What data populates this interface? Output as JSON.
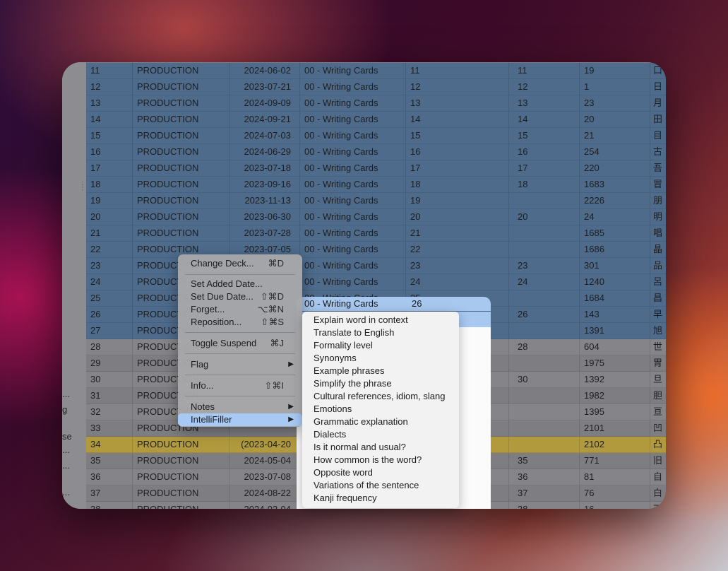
{
  "side_fragments": [
    "...",
    "g",
    "se",
    "...",
    "...",
    "..."
  ],
  "rows": [
    {
      "n": "11",
      "deck": "PRODUCTION",
      "date": "2024-06-02",
      "notetype": "00 - Writing Cards",
      "f1": "11",
      "f2": "11",
      "f3": "19",
      "k": "口",
      "style": "sel"
    },
    {
      "n": "12",
      "deck": "PRODUCTION",
      "date": "2023-07-21",
      "notetype": "00 - Writing Cards",
      "f1": "12",
      "f2": "12",
      "f3": "1",
      "k": "日",
      "style": "sel"
    },
    {
      "n": "13",
      "deck": "PRODUCTION",
      "date": "2024-09-09",
      "notetype": "00 - Writing Cards",
      "f1": "13",
      "f2": "13",
      "f3": "23",
      "k": "月",
      "style": "sel"
    },
    {
      "n": "14",
      "deck": "PRODUCTION",
      "date": "2024-09-21",
      "notetype": "00 - Writing Cards",
      "f1": "14",
      "f2": "14",
      "f3": "20",
      "k": "田",
      "style": "sel"
    },
    {
      "n": "15",
      "deck": "PRODUCTION",
      "date": "2024-07-03",
      "notetype": "00 - Writing Cards",
      "f1": "15",
      "f2": "15",
      "f3": "21",
      "k": "目",
      "style": "sel"
    },
    {
      "n": "16",
      "deck": "PRODUCTION",
      "date": "2024-06-29",
      "notetype": "00 - Writing Cards",
      "f1": "16",
      "f2": "16",
      "f3": "254",
      "k": "古",
      "style": "sel"
    },
    {
      "n": "17",
      "deck": "PRODUCTION",
      "date": "2023-07-18",
      "notetype": "00 - Writing Cards",
      "f1": "17",
      "f2": "17",
      "f3": "220",
      "k": "吾",
      "style": "sel"
    },
    {
      "n": "18",
      "deck": "PRODUCTION",
      "date": "2023-09-16",
      "notetype": "00 - Writing Cards",
      "f1": "18",
      "f2": "18",
      "f3": "1683",
      "k": "冒",
      "style": "sel"
    },
    {
      "n": "19",
      "deck": "PRODUCTION",
      "date": "2023-11-13",
      "notetype": "00 - Writing Cards",
      "f1": "19",
      "f2": "",
      "f3": "2226",
      "k": "朋",
      "style": "sel"
    },
    {
      "n": "20",
      "deck": "PRODUCTION",
      "date": "2023-06-30",
      "notetype": "00 - Writing Cards",
      "f1": "20",
      "f2": "20",
      "f3": "24",
      "k": "明",
      "style": "sel"
    },
    {
      "n": "21",
      "deck": "PRODUCTION",
      "date": "2023-07-28",
      "notetype": "00 - Writing Cards",
      "f1": "21",
      "f2": "",
      "f3": "1685",
      "k": "唱",
      "style": "sel"
    },
    {
      "n": "22",
      "deck": "PRODUCTION",
      "date": "2023-07-05",
      "notetype": "00 - Writing Cards",
      "f1": "22",
      "f2": "",
      "f3": "1686",
      "k": "晶",
      "style": "sel"
    },
    {
      "n": "23",
      "deck": "PRODUCTION",
      "date": "",
      "notetype": "00 - Writing Cards",
      "f1": "23",
      "f2": "23",
      "f3": "301",
      "k": "品",
      "style": "sel"
    },
    {
      "n": "24",
      "deck": "PRODUCTION",
      "date": "",
      "notetype": "00 - Writing Cards",
      "f1": "24",
      "f2": "24",
      "f3": "1240",
      "k": "呂",
      "style": "sel"
    },
    {
      "n": "25",
      "deck": "PRODUCTION",
      "date": "",
      "notetype": "00 - Writing Cards",
      "f1": "25",
      "f2": "",
      "f3": "1684",
      "k": "昌",
      "style": "sel"
    },
    {
      "n": "26",
      "deck": "PRODUCTION",
      "date": "",
      "notetype": "",
      "f1": "",
      "f2": "26",
      "f3": "143",
      "k": "早",
      "style": "sel"
    },
    {
      "n": "27",
      "deck": "PRODUCTION",
      "date": "",
      "notetype": "",
      "f1": "",
      "f2": "",
      "f3": "1391",
      "k": "旭",
      "style": "sel"
    },
    {
      "n": "28",
      "deck": "PRODUCTION",
      "date": "",
      "notetype": "",
      "f1": "",
      "f2": "28",
      "f3": "604",
      "k": "世",
      "style": "gray"
    },
    {
      "n": "29",
      "deck": "PRODUCTION",
      "date": "",
      "notetype": "",
      "f1": "",
      "f2": "",
      "f3": "1975",
      "k": "胃",
      "style": "gray alt"
    },
    {
      "n": "30",
      "deck": "PRODUCTION",
      "date": "",
      "notetype": "",
      "f1": "",
      "f2": "30",
      "f3": "1392",
      "k": "旦",
      "style": "gray"
    },
    {
      "n": "31",
      "deck": "PRODUCTION",
      "date": "",
      "notetype": "",
      "f1": "",
      "f2": "",
      "f3": "1982",
      "k": "胆",
      "style": "gray alt"
    },
    {
      "n": "32",
      "deck": "PRODUCTION",
      "date": "",
      "notetype": "",
      "f1": "",
      "f2": "",
      "f3": "1395",
      "k": "亘",
      "style": "gray"
    },
    {
      "n": "33",
      "deck": "PRODUCTION",
      "date": "",
      "notetype": "",
      "f1": "",
      "f2": "",
      "f3": "2101",
      "k": "凹",
      "style": "gray alt"
    },
    {
      "n": "34",
      "deck": "PRODUCTION",
      "date": "(2023-04-20",
      "notetype": "",
      "f1": "",
      "f2": "",
      "f3": "2102",
      "k": "凸",
      "style": "hl"
    },
    {
      "n": "35",
      "deck": "PRODUCTION",
      "date": "2024-05-04",
      "notetype": "",
      "f1": "",
      "f2": "35",
      "f3": "771",
      "k": "旧",
      "style": "gray alt"
    },
    {
      "n": "36",
      "deck": "PRODUCTION",
      "date": "2023-07-08",
      "notetype": "",
      "f1": "",
      "f2": "36",
      "f3": "81",
      "k": "自",
      "style": "gray"
    },
    {
      "n": "37",
      "deck": "PRODUCTION",
      "date": "2024-08-22",
      "notetype": "",
      "f1": "",
      "f2": "37",
      "f3": "76",
      "k": "白",
      "style": "gray alt"
    },
    {
      "n": "38",
      "deck": "PRODUCTION",
      "date": "2024-03-04",
      "notetype": "",
      "f1": "",
      "f2": "38",
      "f3": "16",
      "k": "百",
      "style": "gray"
    }
  ],
  "highlight_row": {
    "notetype": "00 - Writing Cards",
    "f1": "26"
  },
  "context_menu": {
    "items": [
      {
        "label": "Change Deck...",
        "shortcut": "⌘D"
      },
      {
        "label": "Set Added Date...",
        "shortcut": ""
      },
      {
        "label": "Set Due Date...",
        "shortcut": "⇧⌘D"
      },
      {
        "label": "Forget...",
        "shortcut": "⌥⌘N"
      },
      {
        "label": "Reposition...",
        "shortcut": "⇧⌘S"
      },
      {
        "label": "Toggle Suspend",
        "shortcut": "⌘J"
      },
      {
        "label": "Flag",
        "shortcut": ""
      },
      {
        "label": "Info...",
        "shortcut": "⇧⌘I"
      },
      {
        "label": "Notes",
        "shortcut": ""
      },
      {
        "label": "IntelliFiller",
        "shortcut": ""
      }
    ]
  },
  "submenu": {
    "items": [
      "Explain word in context",
      "Translate to English",
      "Formality level",
      "Synonyms",
      "Example phrases",
      "Simplify the phrase",
      "Cultural references, idiom, slang",
      "Emotions",
      "Grammatic explanation",
      "Dialects",
      "Is it normal and usual?",
      "How common is the word?",
      "Opposite word",
      "Variations of the sentence",
      "Kanji frequency"
    ]
  }
}
